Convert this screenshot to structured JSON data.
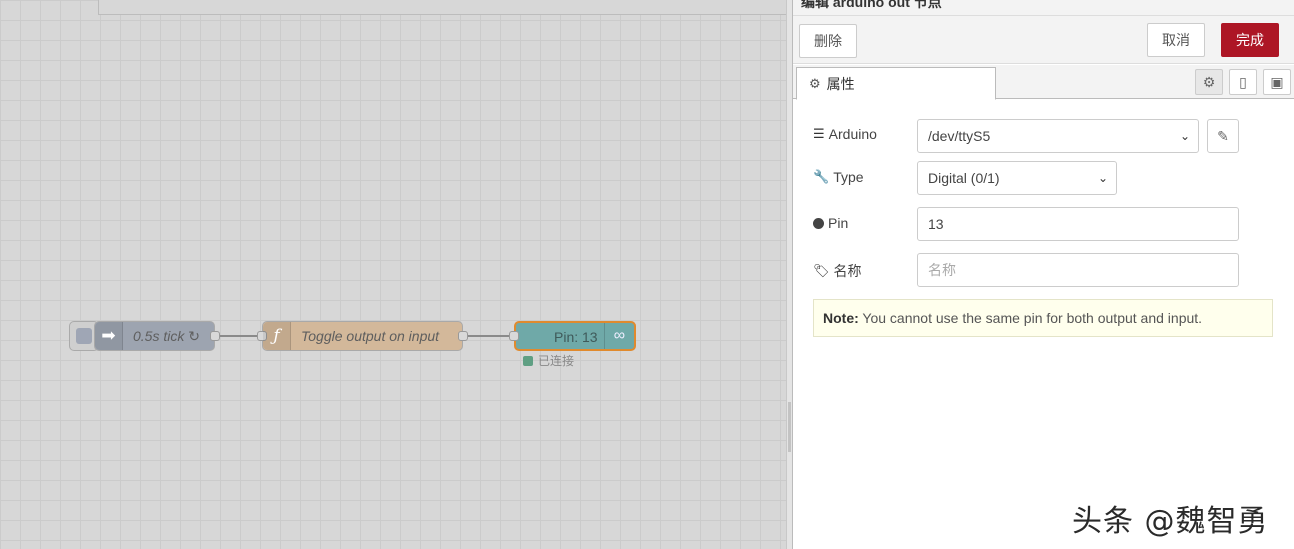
{
  "tray": {
    "title": "编辑 arduino out 节点",
    "delete_label": "删除",
    "cancel_label": "取消",
    "done_label": "完成",
    "tab_properties_label": "属性",
    "settings_icon": "⚙",
    "info_icon": "▯",
    "appearance_icon": "▣"
  },
  "form": {
    "arduino_label": "Arduino",
    "arduino_value": "/dev/ttyS5",
    "type_label": "Type",
    "type_value": "Digital (0/1)",
    "pin_label": "Pin",
    "pin_value": "13",
    "name_label": "名称",
    "name_placeholder": "名称",
    "note_bold": "Note:",
    "note_text": " You cannot use the same pin for both output and input."
  },
  "flow": {
    "inject_label": "0.5s tick ↻",
    "function_label": "Toggle output on input",
    "arduino_label": "Pin: 13",
    "arduino_status": "已连接"
  },
  "watermark": "头条 @魏智勇",
  "colors": {
    "done_button": "#ad1625",
    "inject_node": "#9da4b0",
    "function_node": "#d3b89a",
    "arduino_node": "#6fa9a8",
    "selected_outline": "#e08a2e"
  }
}
